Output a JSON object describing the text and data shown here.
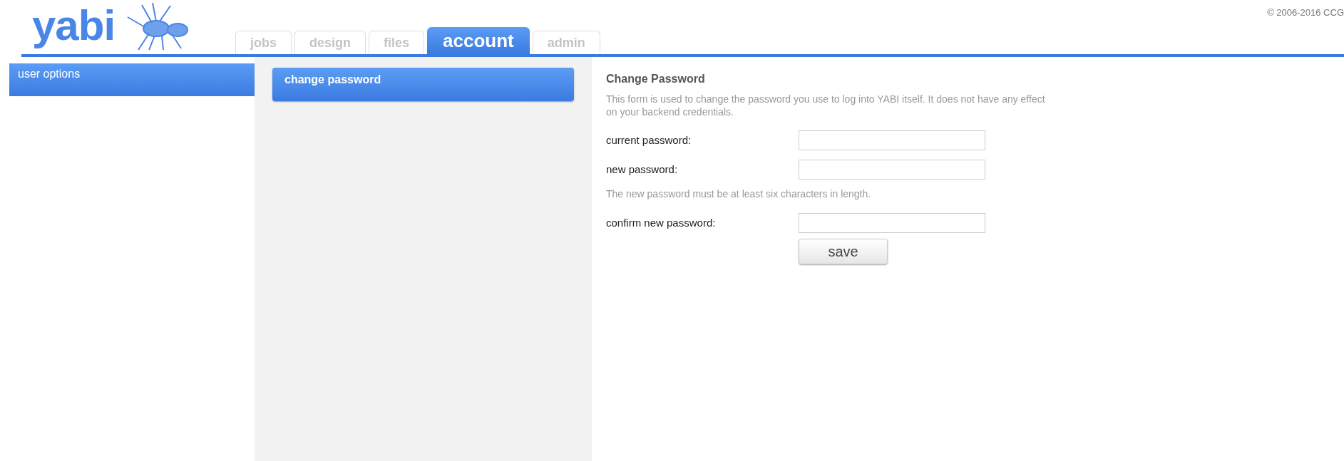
{
  "logo": {
    "text": "yabi"
  },
  "copyright": "© 2006-2016 CCG",
  "tabs": [
    {
      "label": "jobs",
      "selected": false
    },
    {
      "label": "design",
      "selected": false
    },
    {
      "label": "files",
      "selected": false
    },
    {
      "label": "account",
      "selected": true
    },
    {
      "label": "admin",
      "selected": false
    }
  ],
  "sidebar": {
    "items": [
      {
        "label": "user options",
        "selected": true
      }
    ]
  },
  "options": {
    "items": [
      {
        "label": "change password",
        "selected": true
      }
    ]
  },
  "form": {
    "title": "Change Password",
    "description": "This form is used to change the password you use to log into YABI itself. It does not have any effect on your backend credentials.",
    "rows": [
      {
        "kind": "field",
        "label": "current password:"
      },
      {
        "kind": "field",
        "label": "new password:"
      },
      {
        "kind": "hint",
        "text": "The new password must be at least six characters in length."
      },
      {
        "kind": "field",
        "label": "confirm new password:"
      }
    ],
    "button": "save"
  }
}
